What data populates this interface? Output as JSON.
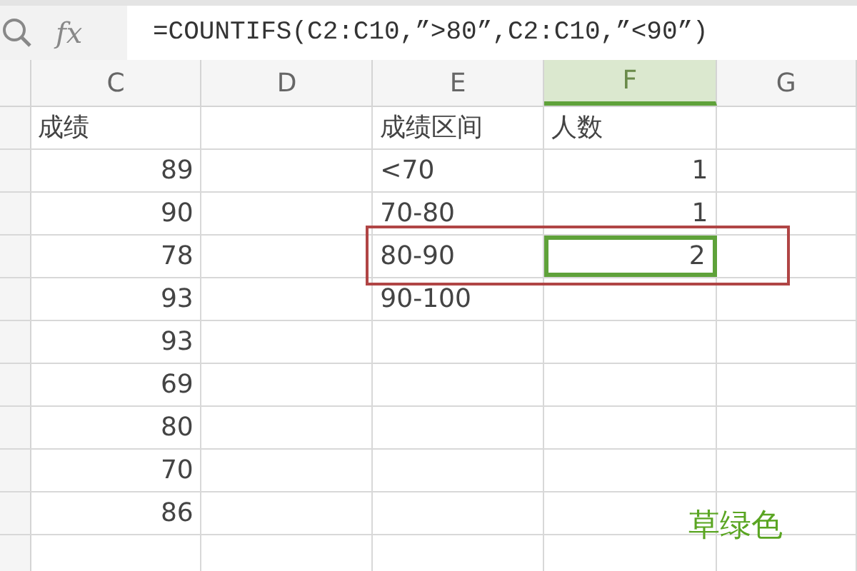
{
  "formula_bar": {
    "fx_label": "fx",
    "formula": "=COUNTIFS(C2:C10,”>80”,C2:C10,”<90”)"
  },
  "columns": [
    {
      "label": "C",
      "selected": false
    },
    {
      "label": "D",
      "selected": false
    },
    {
      "label": "E",
      "selected": false
    },
    {
      "label": "F",
      "selected": true
    },
    {
      "label": "G",
      "selected": false
    }
  ],
  "rows": [
    {
      "c": {
        "kind": "text",
        "text": "成绩",
        "selected": false
      },
      "e": {
        "kind": "text",
        "text": "成绩区间",
        "selected": false
      },
      "f": {
        "kind": "text",
        "text": "人数",
        "selected": false
      }
    },
    {
      "c": {
        "kind": "number",
        "text": "89",
        "selected": false
      },
      "e": {
        "kind": "text",
        "text": "<70",
        "selected": false
      },
      "f": {
        "kind": "number",
        "text": "1",
        "selected": false
      }
    },
    {
      "c": {
        "kind": "number",
        "text": "90",
        "selected": false
      },
      "e": {
        "kind": "text",
        "text": "70-80",
        "selected": false
      },
      "f": {
        "kind": "number",
        "text": "1",
        "selected": false
      }
    },
    {
      "c": {
        "kind": "number",
        "text": "78",
        "selected": false
      },
      "e": {
        "kind": "text",
        "text": "80-90",
        "selected": false
      },
      "f": {
        "kind": "number",
        "text": "2",
        "selected": true
      }
    },
    {
      "c": {
        "kind": "number",
        "text": "93",
        "selected": false
      },
      "e": {
        "kind": "text",
        "text": "90-100",
        "selected": false
      }
    },
    {
      "c": {
        "kind": "number",
        "text": "93",
        "selected": false
      }
    },
    {
      "c": {
        "kind": "number",
        "text": "69",
        "selected": false
      }
    },
    {
      "c": {
        "kind": "number",
        "text": "80",
        "selected": false
      }
    },
    {
      "c": {
        "kind": "number",
        "text": "70",
        "selected": false
      }
    },
    {
      "c": {
        "kind": "number",
        "text": "86",
        "selected": false
      }
    },
    {}
  ],
  "note": "草绿色"
}
